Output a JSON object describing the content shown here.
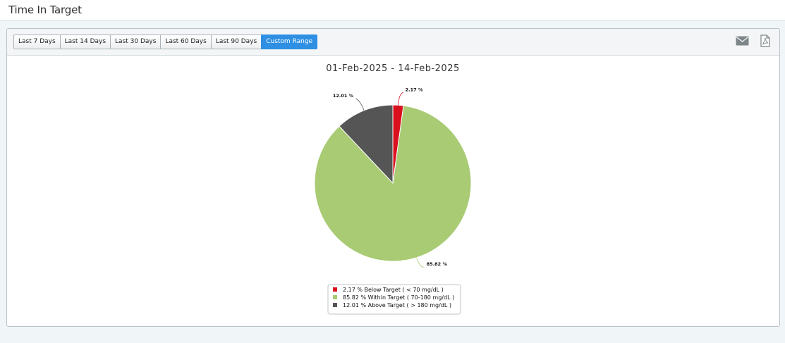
{
  "page": {
    "title": "Time In Target"
  },
  "toolbar": {
    "ranges": [
      {
        "label": "Last 7 Days"
      },
      {
        "label": "Last 14 Days"
      },
      {
        "label": "Last 30 Days"
      },
      {
        "label": "Last 60 Days"
      },
      {
        "label": "Last 90 Days"
      },
      {
        "label": "Custom Range",
        "active": true
      }
    ],
    "icons": [
      "envelope-icon",
      "pdf-icon"
    ]
  },
  "colors": {
    "below": "#d9101e",
    "within": "#a8cb74",
    "above": "#555555",
    "active_button": "#2e8fe3"
  },
  "chart_data": {
    "type": "pie",
    "title": "01-Feb-2025 - 14-Feb-2025",
    "slices": [
      {
        "value": 2.17,
        "label": "2.17 %",
        "legend": "2.17 % Below Target ( < 70 mg/dL )",
        "color": "#d9101e"
      },
      {
        "value": 85.82,
        "label": "85.82 %",
        "legend": "85.82 % Within Target ( 70-180 mg/dL )",
        "color": "#a8cb74"
      },
      {
        "value": 12.01,
        "label": "12.01 %",
        "legend": "12.01 % Above Target ( > 180 mg/dL )",
        "color": "#555555"
      }
    ],
    "legend_position": "bottom"
  }
}
